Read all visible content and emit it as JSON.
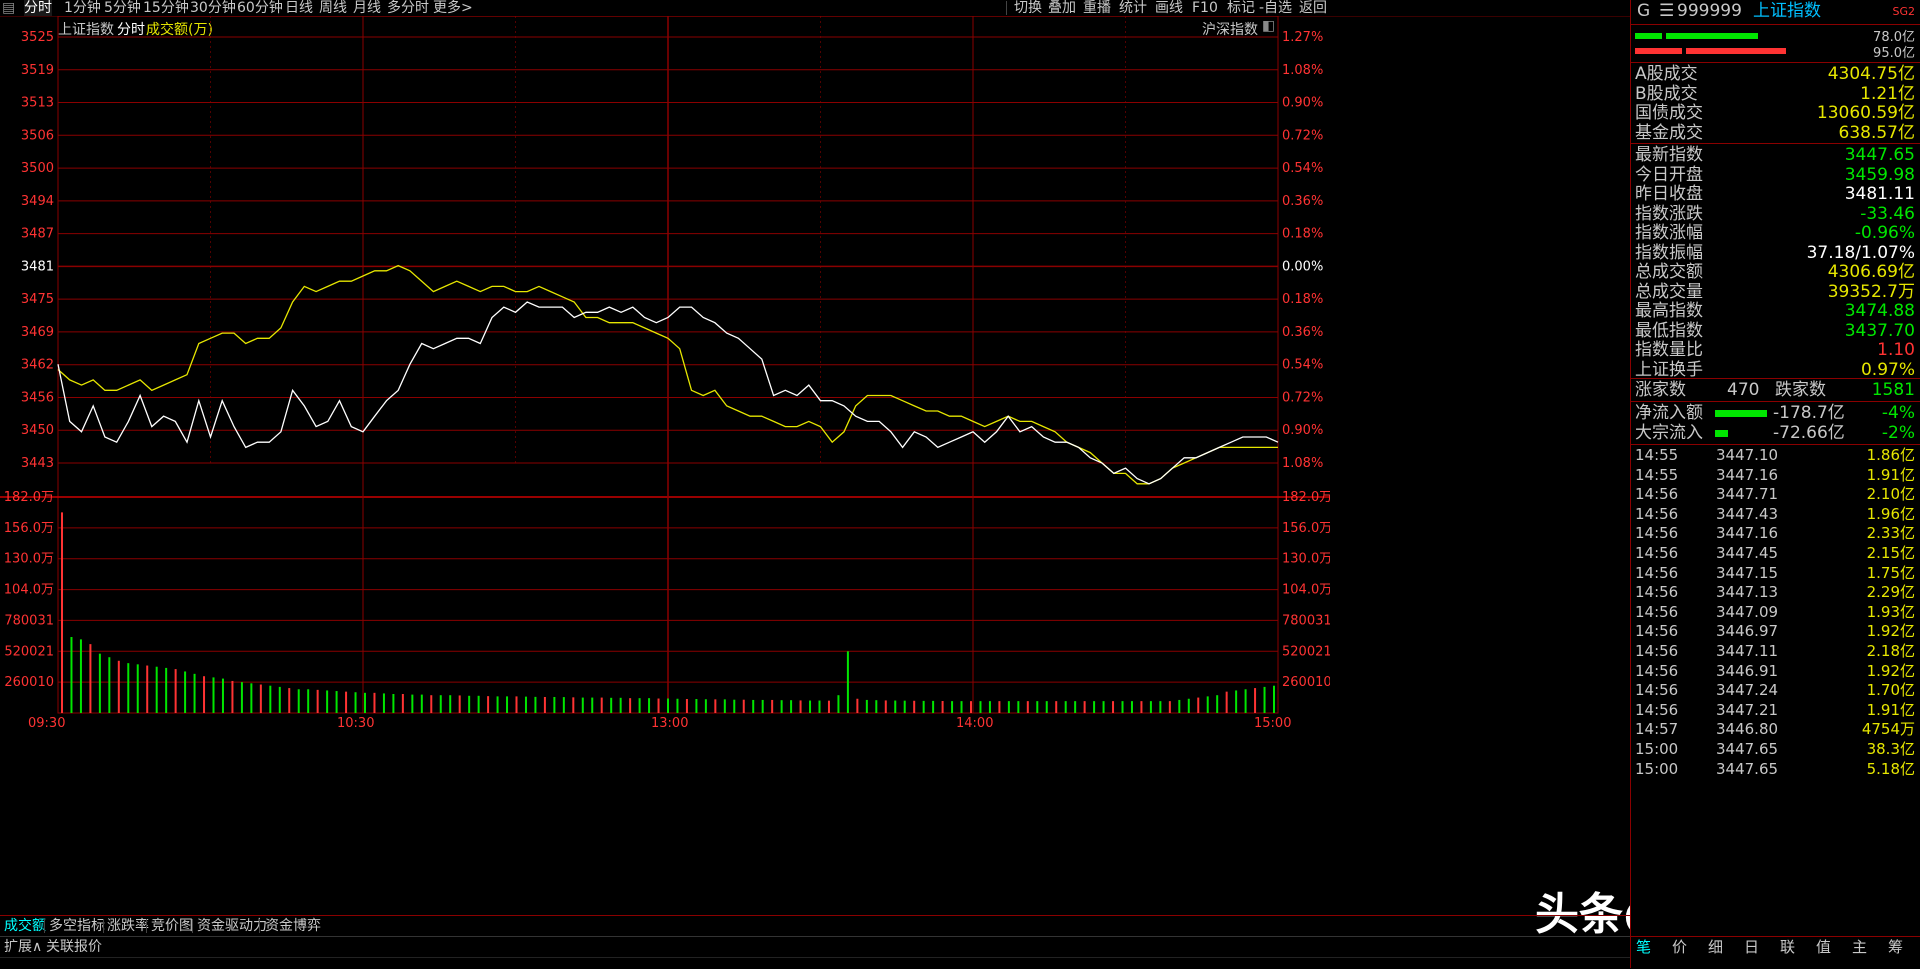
{
  "toolbar": {
    "tabs": [
      "分时",
      "1分钟",
      "5分钟",
      "15分钟",
      "30分钟",
      "60分钟",
      "日线",
      "周线",
      "月线",
      "多分时",
      "更多>"
    ],
    "right_tabs": [
      "切换",
      "叠加",
      "重播",
      "统计",
      "画线",
      "F10",
      "标记",
      "-自选",
      "返回"
    ]
  },
  "chart_header": {
    "index_name": "上证指数",
    "mode": "分时",
    "volume_label": "成交额(万)",
    "overlay_name": "沪深指数"
  },
  "panel": {
    "code_prefix": "G",
    "code": "999999",
    "name": "上证指数",
    "corner": "SG2",
    "bar_values": [
      "78.0亿",
      "95.0亿"
    ],
    "turnover": [
      {
        "label": "A股成交",
        "value": "4304.75亿"
      },
      {
        "label": "B股成交",
        "value": "1.21亿"
      },
      {
        "label": "国债成交",
        "value": "13060.59亿"
      },
      {
        "label": "基金成交",
        "value": "638.57亿"
      }
    ],
    "stats": [
      {
        "label": "最新指数",
        "value": "3447.65",
        "color": "green"
      },
      {
        "label": "今日开盘",
        "value": "3459.98",
        "color": "green"
      },
      {
        "label": "昨日收盘",
        "value": "3481.11",
        "color": "white"
      },
      {
        "label": "指数涨跌",
        "value": "-33.46",
        "color": "green"
      },
      {
        "label": "指数涨幅",
        "value": "-0.96%",
        "color": "green"
      },
      {
        "label": "指数振幅",
        "value": "37.18/1.07%",
        "color": "white"
      },
      {
        "label": "总成交额",
        "value": "4306.69亿",
        "color": "yellow"
      },
      {
        "label": "总成交量",
        "value": "39352.7万",
        "color": "yellow"
      },
      {
        "label": "最高指数",
        "value": "3474.88",
        "color": "green"
      },
      {
        "label": "最低指数",
        "value": "3437.70",
        "color": "green"
      },
      {
        "label": "指数量比",
        "value": "1.10",
        "color": "red"
      },
      {
        "label": "上证换手",
        "value": "0.97%",
        "color": "yellow"
      }
    ],
    "breadth": {
      "up_label": "涨家数",
      "up": "470",
      "down_label": "跌家数",
      "down": "1581"
    },
    "flows": [
      {
        "label": "净流入额",
        "value": "-178.7亿",
        "pct": "-4%",
        "bar": 1.0
      },
      {
        "label": "大宗流入",
        "value": "-72.66亿",
        "pct": "-2%",
        "bar": 0.25
      }
    ],
    "ticks": [
      {
        "time": "14:55",
        "price": "3447.10",
        "amt": "1.86亿"
      },
      {
        "time": "14:55",
        "price": "3447.16",
        "amt": "1.91亿"
      },
      {
        "time": "14:56",
        "price": "3447.71",
        "amt": "2.10亿"
      },
      {
        "time": "14:56",
        "price": "3447.43",
        "amt": "1.96亿"
      },
      {
        "time": "14:56",
        "price": "3447.16",
        "amt": "2.33亿"
      },
      {
        "time": "14:56",
        "price": "3447.45",
        "amt": "2.15亿"
      },
      {
        "time": "14:56",
        "price": "3447.15",
        "amt": "1.75亿"
      },
      {
        "time": "14:56",
        "price": "3447.13",
        "amt": "2.29亿"
      },
      {
        "time": "14:56",
        "price": "3447.09",
        "amt": "1.93亿"
      },
      {
        "time": "14:56",
        "price": "3446.97",
        "amt": "1.92亿"
      },
      {
        "time": "14:56",
        "price": "3447.11",
        "amt": "2.18亿"
      },
      {
        "time": "14:56",
        "price": "3446.91",
        "amt": "1.92亿"
      },
      {
        "time": "14:56",
        "price": "3447.24",
        "amt": "1.70亿"
      },
      {
        "time": "14:56",
        "price": "3447.21",
        "amt": "1.91亿"
      },
      {
        "time": "14:57",
        "price": "3446.80",
        "amt": "4754万"
      },
      {
        "time": "15:00",
        "price": "3447.65",
        "amt": "38.3亿"
      },
      {
        "time": "15:00",
        "price": "3447.65",
        "amt": "5.18亿"
      }
    ],
    "bottom_tabs": [
      "笔",
      "价",
      "细",
      "日",
      "联",
      "值",
      "主",
      "筹"
    ]
  },
  "bottom_tabs": [
    "成交额",
    "多空指标",
    "涨跌率",
    "竞价图",
    "资金驱动力",
    "资金博弈"
  ],
  "status_tabs": [
    "扩展∧",
    "关联报价"
  ],
  "watermark": "头条@溯源归一",
  "colors": {
    "grid": "#8a0000",
    "up": "#ff3333",
    "down": "#00e600",
    "price": "#ffffff",
    "avg": "#e6e600"
  },
  "chart_data": {
    "type": "line",
    "prev_close": 3481.11,
    "price_axis": [
      "3525",
      "3519",
      "3513",
      "3506",
      "3500",
      "3494",
      "3487",
      "3481",
      "3475",
      "3469",
      "3462",
      "3456",
      "3450",
      "3443"
    ],
    "pct_axis": [
      "1.27%",
      "1.08%",
      "0.90%",
      "0.72%",
      "0.54%",
      "0.36%",
      "0.18%",
      "0.00%",
      "0.18%",
      "0.36%",
      "0.54%",
      "0.72%",
      "0.90%",
      "1.08%"
    ],
    "ylim": [
      3440,
      3528
    ],
    "x_ticks": [
      "09:30",
      "10:30",
      "13:00",
      "14:00",
      "15:00"
    ],
    "volume_axis": [
      "182.0万",
      "156.0万",
      "130.0万",
      "104.0万",
      "780031",
      "520021",
      "260010"
    ],
    "volume_max": 1820000,
    "series": [
      {
        "name": "price",
        "color": "#ffffff",
        "values": [
          3462,
          3451,
          3449,
          3454,
          3448,
          3447,
          3451,
          3456,
          3450,
          3452,
          3451,
          3447,
          3455,
          3448,
          3455,
          3450,
          3446,
          3447,
          3447,
          3449,
          3457,
          3454,
          3450,
          3451,
          3455,
          3450,
          3449,
          3452,
          3455,
          3457,
          3462,
          3466,
          3465,
          3466,
          3467,
          3467,
          3466,
          3471,
          3473,
          3472,
          3474,
          3473,
          3473,
          3473,
          3471,
          3472,
          3472,
          3473,
          3472,
          3473,
          3471,
          3470,
          3471,
          3473,
          3473,
          3471,
          3470,
          3468,
          3467,
          3465,
          3463,
          3456,
          3457,
          3456,
          3458,
          3455,
          3455,
          3454,
          3452,
          3451,
          3451,
          3449,
          3446,
          3449,
          3448,
          3446,
          3447,
          3448,
          3449,
          3447,
          3449,
          3452,
          3449,
          3450,
          3448,
          3447,
          3447,
          3446,
          3444,
          3443,
          3441,
          3442,
          3440,
          3439,
          3440,
          3442,
          3444,
          3444,
          3445,
          3446,
          3447,
          3448,
          3448,
          3448,
          3447
        ]
      },
      {
        "name": "avg",
        "color": "#e6e600",
        "values": [
          3461,
          3459,
          3458,
          3459,
          3457,
          3457,
          3458,
          3459,
          3457,
          3458,
          3459,
          3460,
          3466,
          3467,
          3468,
          3468,
          3466,
          3467,
          3467,
          3469,
          3474,
          3477,
          3476,
          3477,
          3478,
          3478,
          3479,
          3480,
          3480,
          3481,
          3480,
          3478,
          3476,
          3477,
          3478,
          3477,
          3476,
          3477,
          3477,
          3476,
          3476,
          3477,
          3476,
          3475,
          3474,
          3471,
          3471,
          3470,
          3470,
          3470,
          3469,
          3468,
          3467,
          3465,
          3457,
          3456,
          3457,
          3454,
          3453,
          3452,
          3452,
          3451,
          3450,
          3450,
          3451,
          3450,
          3447,
          3449,
          3454,
          3456,
          3456,
          3456,
          3455,
          3454,
          3453,
          3453,
          3452,
          3452,
          3451,
          3450,
          3451,
          3452,
          3451,
          3451,
          3450,
          3449,
          3447,
          3446,
          3445,
          3443,
          3441,
          3441,
          3439,
          3439,
          3440,
          3442,
          3443,
          3444,
          3445,
          3446,
          3446,
          3446,
          3446,
          3446,
          3446
        ]
      },
      {
        "name": "volume",
        "color": "#00e600",
        "values": [
          1690000,
          640000,
          620000,
          580000,
          500000,
          470000,
          440000,
          420000,
          410000,
          400000,
          390000,
          380000,
          370000,
          350000,
          330000,
          310000,
          300000,
          290000,
          270000,
          260000,
          250000,
          240000,
          230000,
          220000,
          210000,
          200000,
          200000,
          195000,
          190000,
          185000,
          180000,
          175000,
          170000,
          170000,
          165000,
          160000,
          160000,
          155000,
          155000,
          150000,
          150000,
          150000,
          148000,
          145000,
          145000,
          142000,
          140000,
          140000,
          140000,
          138000,
          136000,
          135000,
          135000,
          134000,
          132000,
          130000,
          130000,
          130000,
          128000,
          128000,
          125000,
          125000,
          125000,
          122000,
          122000,
          120000,
          118000,
          118000,
          116000,
          115000,
          115000,
          112000,
          112000,
          110000,
          110000,
          110000,
          108000,
          108000,
          106000,
          105000,
          105000,
          104000,
          150000,
          520000,
          120000,
          110000,
          108000,
          106000,
          105000,
          104000,
          103000,
          102000,
          102000,
          101000,
          100000,
          100000,
          100000,
          100000,
          100000,
          100000,
          100000,
          100000,
          100000,
          100000,
          100000,
          100000,
          100000,
          100000,
          100000,
          100000,
          100000,
          100000,
          100000,
          100000,
          100000,
          100000,
          100000,
          100000,
          110000,
          120000,
          130000,
          140000,
          150000,
          180000,
          190000,
          200000,
          210000,
          220000,
          230000
        ]
      }
    ]
  }
}
